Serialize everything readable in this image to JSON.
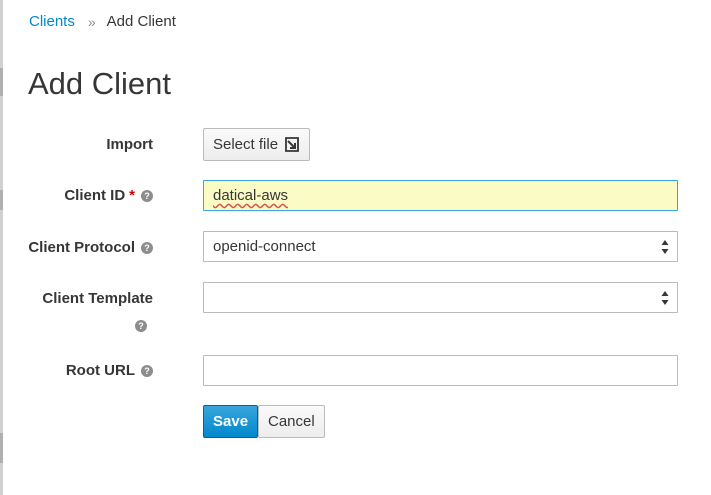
{
  "breadcrumb": {
    "parent": "Clients",
    "separator": "»",
    "current": "Add Client"
  },
  "page": {
    "title": "Add Client"
  },
  "form": {
    "import": {
      "label": "Import",
      "button_label": "Select file"
    },
    "client_id": {
      "label": "Client ID",
      "required_mark": "*",
      "value": "datical-aws"
    },
    "client_protocol": {
      "label": "Client Protocol",
      "selected": "openid-connect"
    },
    "client_template": {
      "label": "Client Template",
      "selected": ""
    },
    "root_url": {
      "label": "Root URL",
      "value": ""
    }
  },
  "actions": {
    "save_label": "Save",
    "cancel_label": "Cancel"
  },
  "colors": {
    "link": "#0088ce",
    "primary": "#0088ce",
    "focus_bg": "#fbfbc5",
    "required": "#cc0000"
  },
  "icons": {
    "help": "question-circle-icon",
    "import": "import-arrow-icon",
    "select": "select-arrows-icon"
  }
}
